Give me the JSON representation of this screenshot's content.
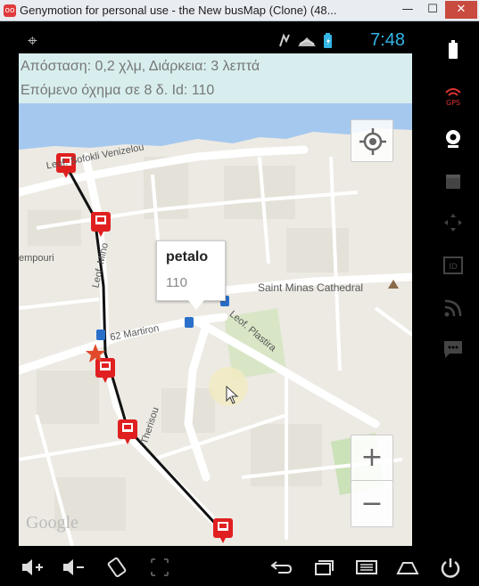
{
  "window": {
    "title": "Genymotion for personal use -  the New busMap (Clone) (48...",
    "minimize_label": "—",
    "maximize_label": "☐",
    "close_label": "✕",
    "icon_label": "oo"
  },
  "statusbar": {
    "time": "7:48",
    "time_color": "#33b5e5"
  },
  "info": {
    "line1": "Απόσταση: 0,2 χλμ, Διάρκεια: 3 λεπτά",
    "line2": "Επόμενο όχημα σε 8 δ. Id: 110"
  },
  "map": {
    "labels": {
      "sofokli": "Leof. Sofokli Venizelou",
      "empouri": "empouri",
      "minoos": "Leof. Mino",
      "martiron": "62 Martiron",
      "plastira": "Leof. Plastira",
      "saint_minas": "Saint Minas Cathedral",
      "therisou": "Therisou"
    },
    "route_color": "#111111",
    "bus_stop_color": "#e02020",
    "google_logo": "Google",
    "zoom_in": "+",
    "zoom_out": "−"
  },
  "infowindow": {
    "title": "petalo",
    "subtitle": "110"
  },
  "sidebar": {
    "icons": [
      "battery-icon",
      "gps-icon",
      "webcam-icon",
      "clapper-icon",
      "dpad-icon",
      "id-icon",
      "rss-icon",
      "sms-icon"
    ]
  },
  "navbar": {
    "icons": [
      "volume-up-icon",
      "volume-down-icon",
      "rotate-icon",
      "fullscreen-icon",
      "back-icon",
      "recents-icon",
      "menu-icon",
      "home-icon",
      "power-icon"
    ]
  }
}
